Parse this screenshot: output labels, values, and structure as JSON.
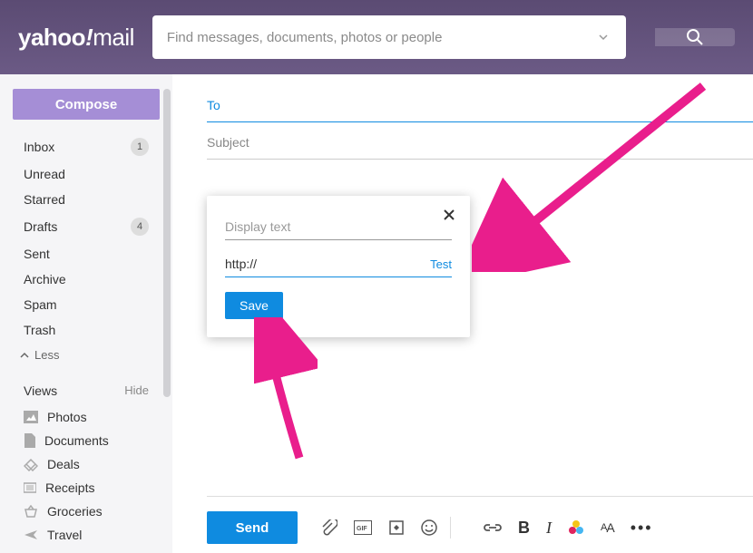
{
  "header": {
    "logo_main": "yahoo",
    "logo_excl": "!",
    "logo_suffix": "mail",
    "search_placeholder": "Find messages, documents, photos or people"
  },
  "sidebar": {
    "compose_label": "Compose",
    "folders": [
      {
        "label": "Inbox",
        "count": "1"
      },
      {
        "label": "Unread",
        "count": ""
      },
      {
        "label": "Starred",
        "count": ""
      },
      {
        "label": "Drafts",
        "count": "4"
      },
      {
        "label": "Sent",
        "count": ""
      },
      {
        "label": "Archive",
        "count": ""
      },
      {
        "label": "Spam",
        "count": ""
      },
      {
        "label": "Trash",
        "count": ""
      }
    ],
    "less_label": "Less",
    "views_label": "Views",
    "hide_label": "Hide",
    "views": [
      {
        "label": "Photos",
        "icon": "photos"
      },
      {
        "label": "Documents",
        "icon": "document"
      },
      {
        "label": "Deals",
        "icon": "deals"
      },
      {
        "label": "Receipts",
        "icon": "receipt"
      },
      {
        "label": "Groceries",
        "icon": "basket"
      },
      {
        "label": "Travel",
        "icon": "plane"
      }
    ]
  },
  "compose": {
    "to_label": "To",
    "subject_label": "Subject",
    "send_label": "Send"
  },
  "link_dialog": {
    "display_text_placeholder": "Display text",
    "url_value": "http://",
    "test_label": "Test",
    "save_label": "Save"
  },
  "colors": {
    "accent": "#0f8be0",
    "header_bg": "#6b5a85",
    "compose_btn": "#a58ed6",
    "arrow": "#e91e8c"
  }
}
